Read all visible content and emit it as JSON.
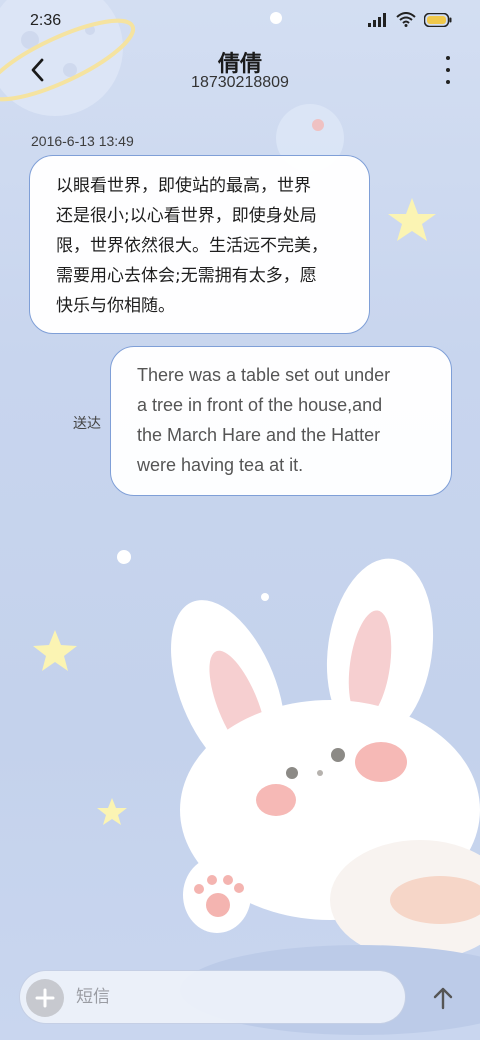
{
  "status_bar": {
    "time": "2:36",
    "icons": [
      "signal-icon",
      "wifi-icon",
      "battery-icon"
    ]
  },
  "header": {
    "contact_name": "倩倩",
    "contact_number": "18730218809",
    "back_icon": "chevron-left-icon",
    "menu_icon": "more-vertical-icon"
  },
  "conversation": {
    "timestamp": "2016-6-13 13:49",
    "incoming_message": {
      "lines": [
        "以眼看世界，即使站的最高，世界",
        "还是很小;以心看世界，即使身处局",
        "限，世界依然很大。生活远不完美，",
        "需要用心去体会;无需拥有太多，愿",
        "快乐与你相随。"
      ]
    },
    "outgoing_message": {
      "lines": [
        "There was a table set out under",
        "a tree in front of the house,and",
        "the March Hare and the Hatter",
        "were having tea at it."
      ],
      "status": "送达"
    }
  },
  "composer": {
    "placeholder": "短信",
    "value": "",
    "attach_icon": "plus-icon",
    "send_icon": "arrow-up-icon"
  },
  "colors": {
    "background": "#c9d6ef",
    "bubble_border": "#7f9fd7",
    "bubble_fill": "#ffffff"
  }
}
